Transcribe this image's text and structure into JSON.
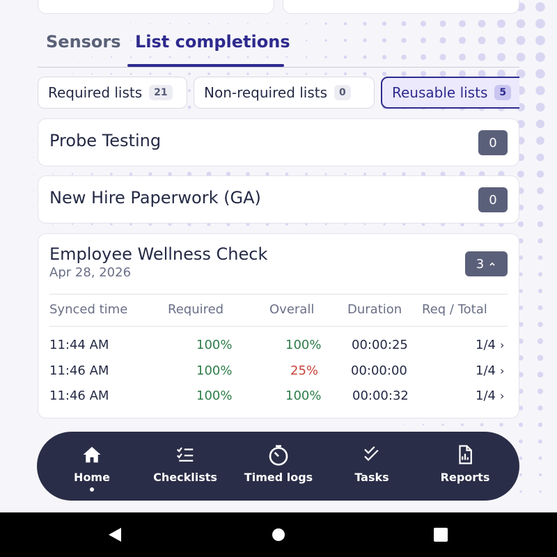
{
  "tabs": [
    {
      "label": "Sensors",
      "active": false
    },
    {
      "label": "List completions",
      "active": true
    }
  ],
  "filters": [
    {
      "label": "Required lists",
      "count": "21",
      "active": false
    },
    {
      "label": "Non-required lists",
      "count": "0",
      "active": false
    },
    {
      "label": "Reusable lists",
      "count": "5",
      "active": true
    }
  ],
  "lists": [
    {
      "title": "Probe Testing",
      "badge": "0"
    },
    {
      "title": "New Hire Paperwork (GA)",
      "badge": "0"
    },
    {
      "title": "Employee Wellness Check",
      "date": "Apr 28, 2026",
      "badge": "3",
      "expanded": true,
      "columns": [
        "Synced time",
        "Required",
        "Overall",
        "Duration",
        "Req / Total"
      ],
      "rows": [
        {
          "synced": "11:44 AM",
          "required": "100%",
          "overall": "100%",
          "duration": "00:00:25",
          "req_total": "1/4"
        },
        {
          "synced": "11:46 AM",
          "required": "100%",
          "overall": "25%",
          "duration": "00:00:00",
          "req_total": "1/4"
        },
        {
          "synced": "11:46 AM",
          "required": "100%",
          "overall": "100%",
          "duration": "00:00:32",
          "req_total": "1/4"
        }
      ]
    }
  ],
  "bottom_nav": [
    {
      "label": "Home",
      "icon": "home-icon",
      "active": true
    },
    {
      "label": "Checklists",
      "icon": "checklist-icon",
      "active": false
    },
    {
      "label": "Timed logs",
      "icon": "timer-icon",
      "active": false
    },
    {
      "label": "Tasks",
      "icon": "double-check-icon",
      "active": false
    },
    {
      "label": "Reports",
      "icon": "report-icon",
      "active": false
    }
  ],
  "colors": {
    "accent": "#2e2a8e",
    "nav_bg": "#2a2d47",
    "badge_bg": "#5b607a",
    "ok_green": "#2e7d4a",
    "warn_red": "#c8453a"
  }
}
